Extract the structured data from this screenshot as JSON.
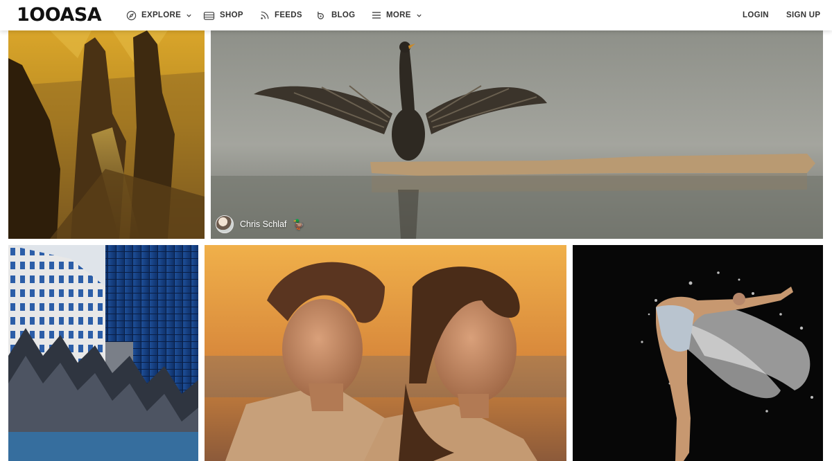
{
  "brand": {
    "logo_text": "1OOASA"
  },
  "nav": {
    "explore": "EXPLORE",
    "shop": "SHOP",
    "feeds": "FEEDS",
    "blog": "BLOG",
    "more": "MORE"
  },
  "auth": {
    "login": "LOGIN",
    "signup": "SIGN UP"
  },
  "photos": [
    {
      "subject": "canyon-spires"
    },
    {
      "subject": "cormorant-wings",
      "photographer": "Chris Schlaf",
      "badge": "🦆"
    },
    {
      "subject": "glass-buildings"
    },
    {
      "subject": "two-women-portrait"
    },
    {
      "subject": "water-splash-dancer"
    }
  ],
  "colors": {
    "nav_text": "#333333",
    "background": "#ffffff"
  }
}
